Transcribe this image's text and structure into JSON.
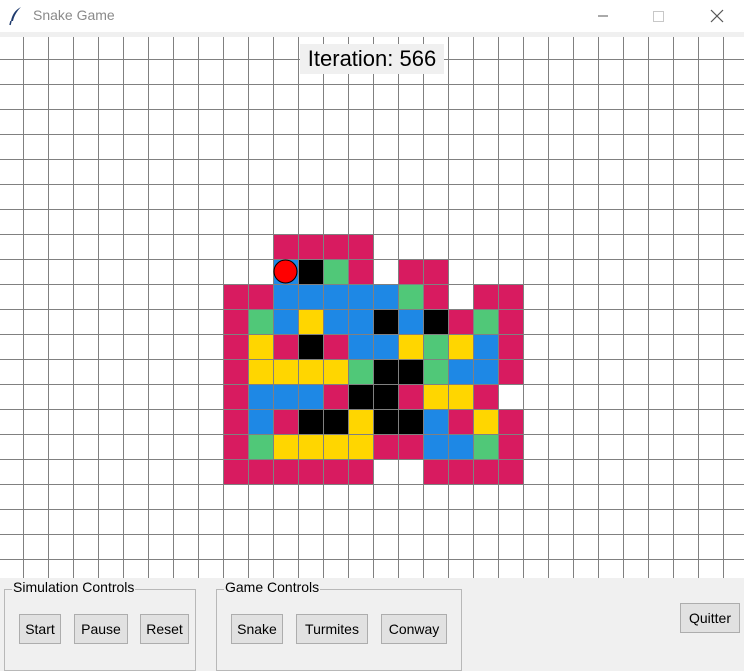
{
  "window": {
    "title": "Snake Game",
    "app_icon": "feather-icon",
    "controls": [
      "minimize-icon",
      "maximize-icon",
      "close-icon"
    ]
  },
  "canvas": {
    "background": "#ffffff",
    "grid_line_color": "#808080",
    "iteration_label": "Iteration: 566",
    "palette": {
      "M": "#d81b60",
      "B": "#1e88e5",
      "G": "#50c878",
      "Y": "#ffd600",
      "K": "#000000",
      "W": "#ffffff"
    },
    "cells_origin": {
      "col": 9,
      "row": 8
    },
    "cells": [
      "..MMMM.......",
      "..BKGM.MM....",
      "MMBBBBBGM.MM.",
      "MGBYBBKBKMGM.",
      "MYMKMBBYGYBM.",
      "MYYYYGKKGBBM.",
      "MBBBMKKMYYM..",
      "MBMKKYKKBMYM.",
      "MGYYYYMMBBGM.",
      "MMMMMM..MMMM."
    ],
    "snake_head": {
      "col": 11,
      "row": 9,
      "color": "#ff0000",
      "outline": "#000000"
    }
  },
  "simulation_controls": {
    "title": "Simulation Controls",
    "buttons": [
      "Start",
      "Pause",
      "Reset"
    ]
  },
  "game_controls": {
    "title": "Game Controls",
    "buttons": [
      "Snake",
      "Turmites",
      "Conway"
    ]
  },
  "quit_button": "Quitter"
}
